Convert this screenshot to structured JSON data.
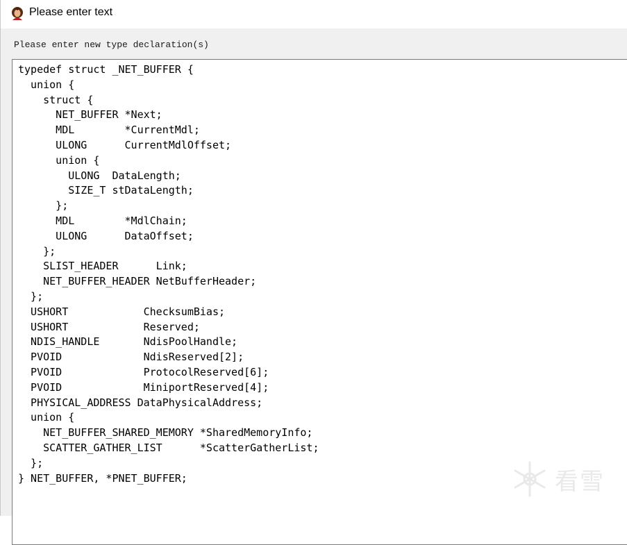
{
  "window": {
    "title": "Please enter text",
    "icon": "user-avatar-icon"
  },
  "dialog": {
    "prompt": "Please enter new type declaration(s)",
    "code_lines": [
      "typedef struct _NET_BUFFER {",
      "  union {",
      "    struct {",
      "      NET_BUFFER *Next;",
      "      MDL        *CurrentMdl;",
      "      ULONG      CurrentMdlOffset;",
      "      union {",
      "        ULONG  DataLength;",
      "        SIZE_T stDataLength;",
      "      };",
      "      MDL        *MdlChain;",
      "      ULONG      DataOffset;",
      "    };",
      "    SLIST_HEADER      Link;",
      "    NET_BUFFER_HEADER NetBufferHeader;",
      "  };",
      "  USHORT            ChecksumBias;",
      "  USHORT            Reserved;",
      "  NDIS_HANDLE       NdisPoolHandle;",
      "  PVOID             NdisReserved[2];",
      "  PVOID             ProtocolReserved[6];",
      "  PVOID             MiniportReserved[4];",
      "  PHYSICAL_ADDRESS DataPhysicalAddress;",
      "  union {",
      "    NET_BUFFER_SHARED_MEMORY *SharedMemoryInfo;",
      "    SCATTER_GATHER_LIST      *ScatterGatherList;",
      "  };",
      "} NET_BUFFER, *PNET_BUFFER;"
    ]
  },
  "watermark": {
    "text": "看雪",
    "icon": "snowflake-logo-icon"
  }
}
